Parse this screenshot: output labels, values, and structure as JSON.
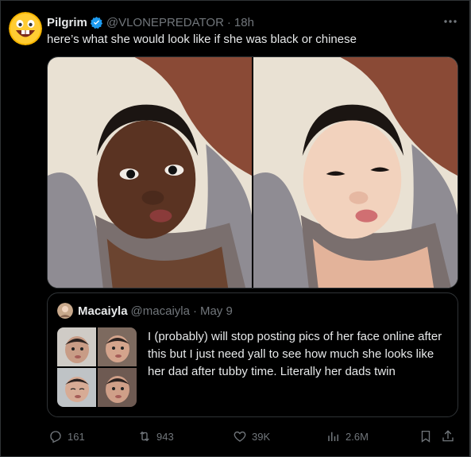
{
  "tweet": {
    "author_name": "Pilgrim",
    "handle": "@VLONEPREDATOR",
    "separator": "·",
    "time": "18h",
    "text": "here’s what she would look like if she was black or chinese",
    "verified": true
  },
  "quote": {
    "author_name": "Macaiyla",
    "handle": "@macaiyla",
    "separator": "·",
    "date": "May 9",
    "text": "I (probably) will stop posting pics of her face online after this but I just need yall to see how much she looks like her dad after tubby time. Literally her dads twin"
  },
  "actions": {
    "replies": "161",
    "reposts": "943",
    "likes": "39K",
    "views": "2.6M"
  },
  "colors": {
    "background": "#000000",
    "text": "#e7e9ea",
    "muted": "#71767b",
    "verified_badge": "#1d9bf0",
    "border": "#2f3336"
  },
  "icons": [
    "emoji-avatar",
    "verified-badge-icon",
    "more-icon",
    "reply-icon",
    "repost-icon",
    "like-icon",
    "views-icon",
    "bookmark-icon",
    "share-icon"
  ]
}
